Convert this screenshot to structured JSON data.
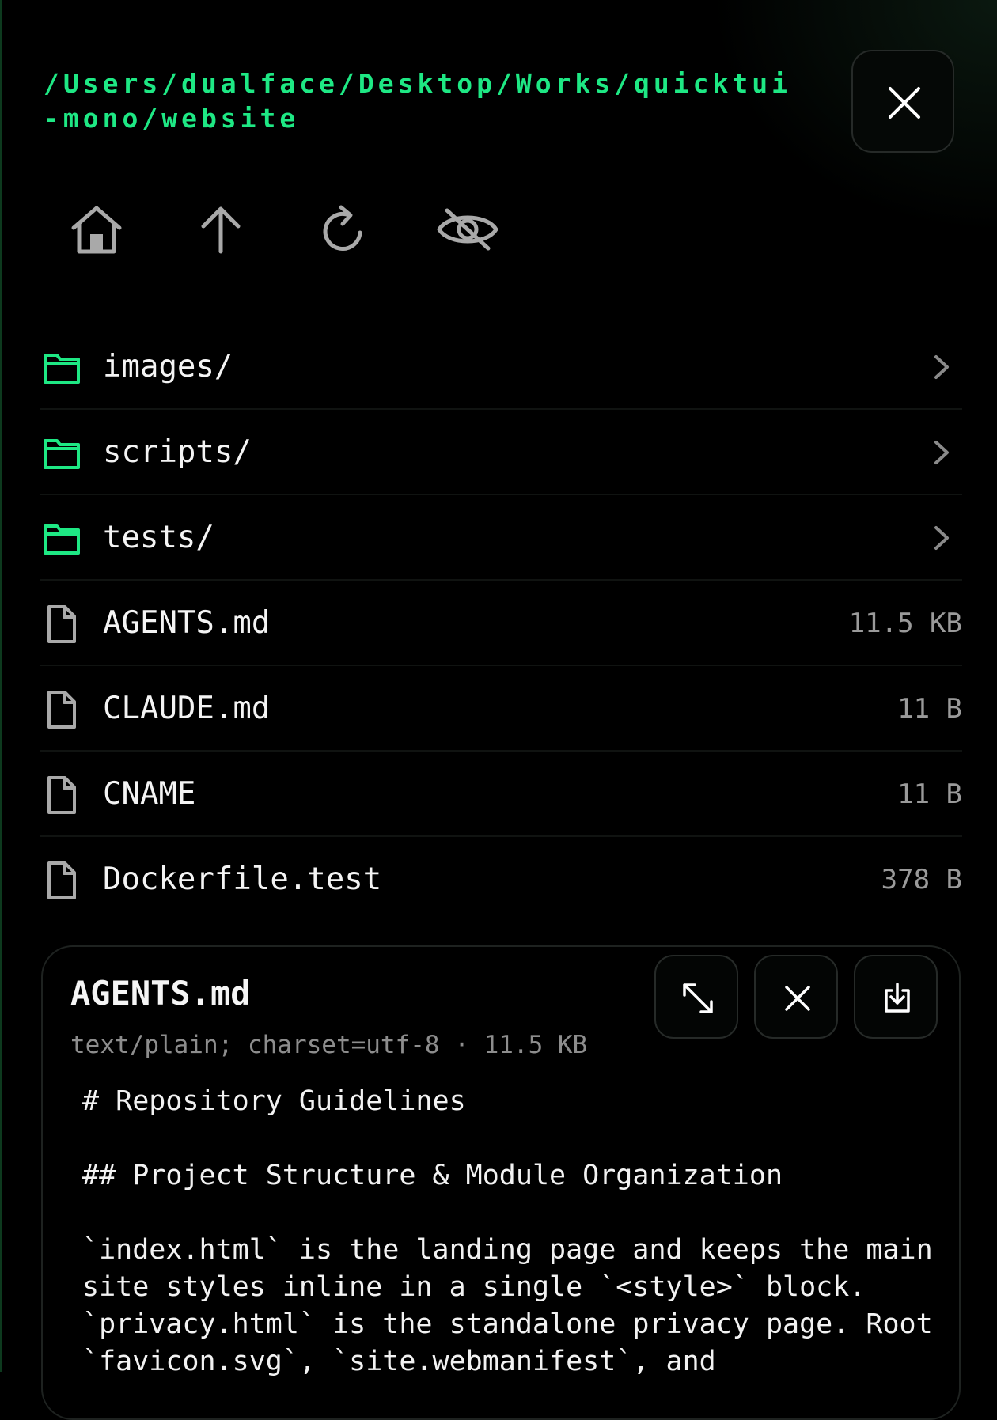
{
  "header": {
    "path": "/Users/dualface/Desktop/Works/quicktui-mono/website",
    "close_icon": "close-icon"
  },
  "toolbar": {
    "icons": [
      "home-icon",
      "arrow-up-icon",
      "refresh-icon",
      "eye-off-icon"
    ]
  },
  "entries": [
    {
      "name": "images/",
      "type": "folder"
    },
    {
      "name": "scripts/",
      "type": "folder"
    },
    {
      "name": "tests/",
      "type": "folder"
    },
    {
      "name": "AGENTS.md",
      "type": "file",
      "size": "11.5 KB"
    },
    {
      "name": "CLAUDE.md",
      "type": "file",
      "size": "11 B"
    },
    {
      "name": "CNAME",
      "type": "file",
      "size": "11 B"
    },
    {
      "name": "Dockerfile.test",
      "type": "file",
      "size": "378 B"
    }
  ],
  "preview": {
    "title": "AGENTS.md",
    "meta": "text/plain; charset=utf-8 · 11.5 KB",
    "content": "# Repository Guidelines\n\n## Project Structure & Module Organization\n\n`index.html` is the landing page and keeps the main site styles inline in a single `<style>` block. `privacy.html` is the standalone privacy page. Root `favicon.svg`, `site.webmanifest`, and",
    "buttons": [
      "expand-icon",
      "close-icon",
      "download-icon"
    ]
  },
  "colors": {
    "accent": "#1ee884",
    "background": "#000000",
    "muted": "#9a9a9a"
  }
}
